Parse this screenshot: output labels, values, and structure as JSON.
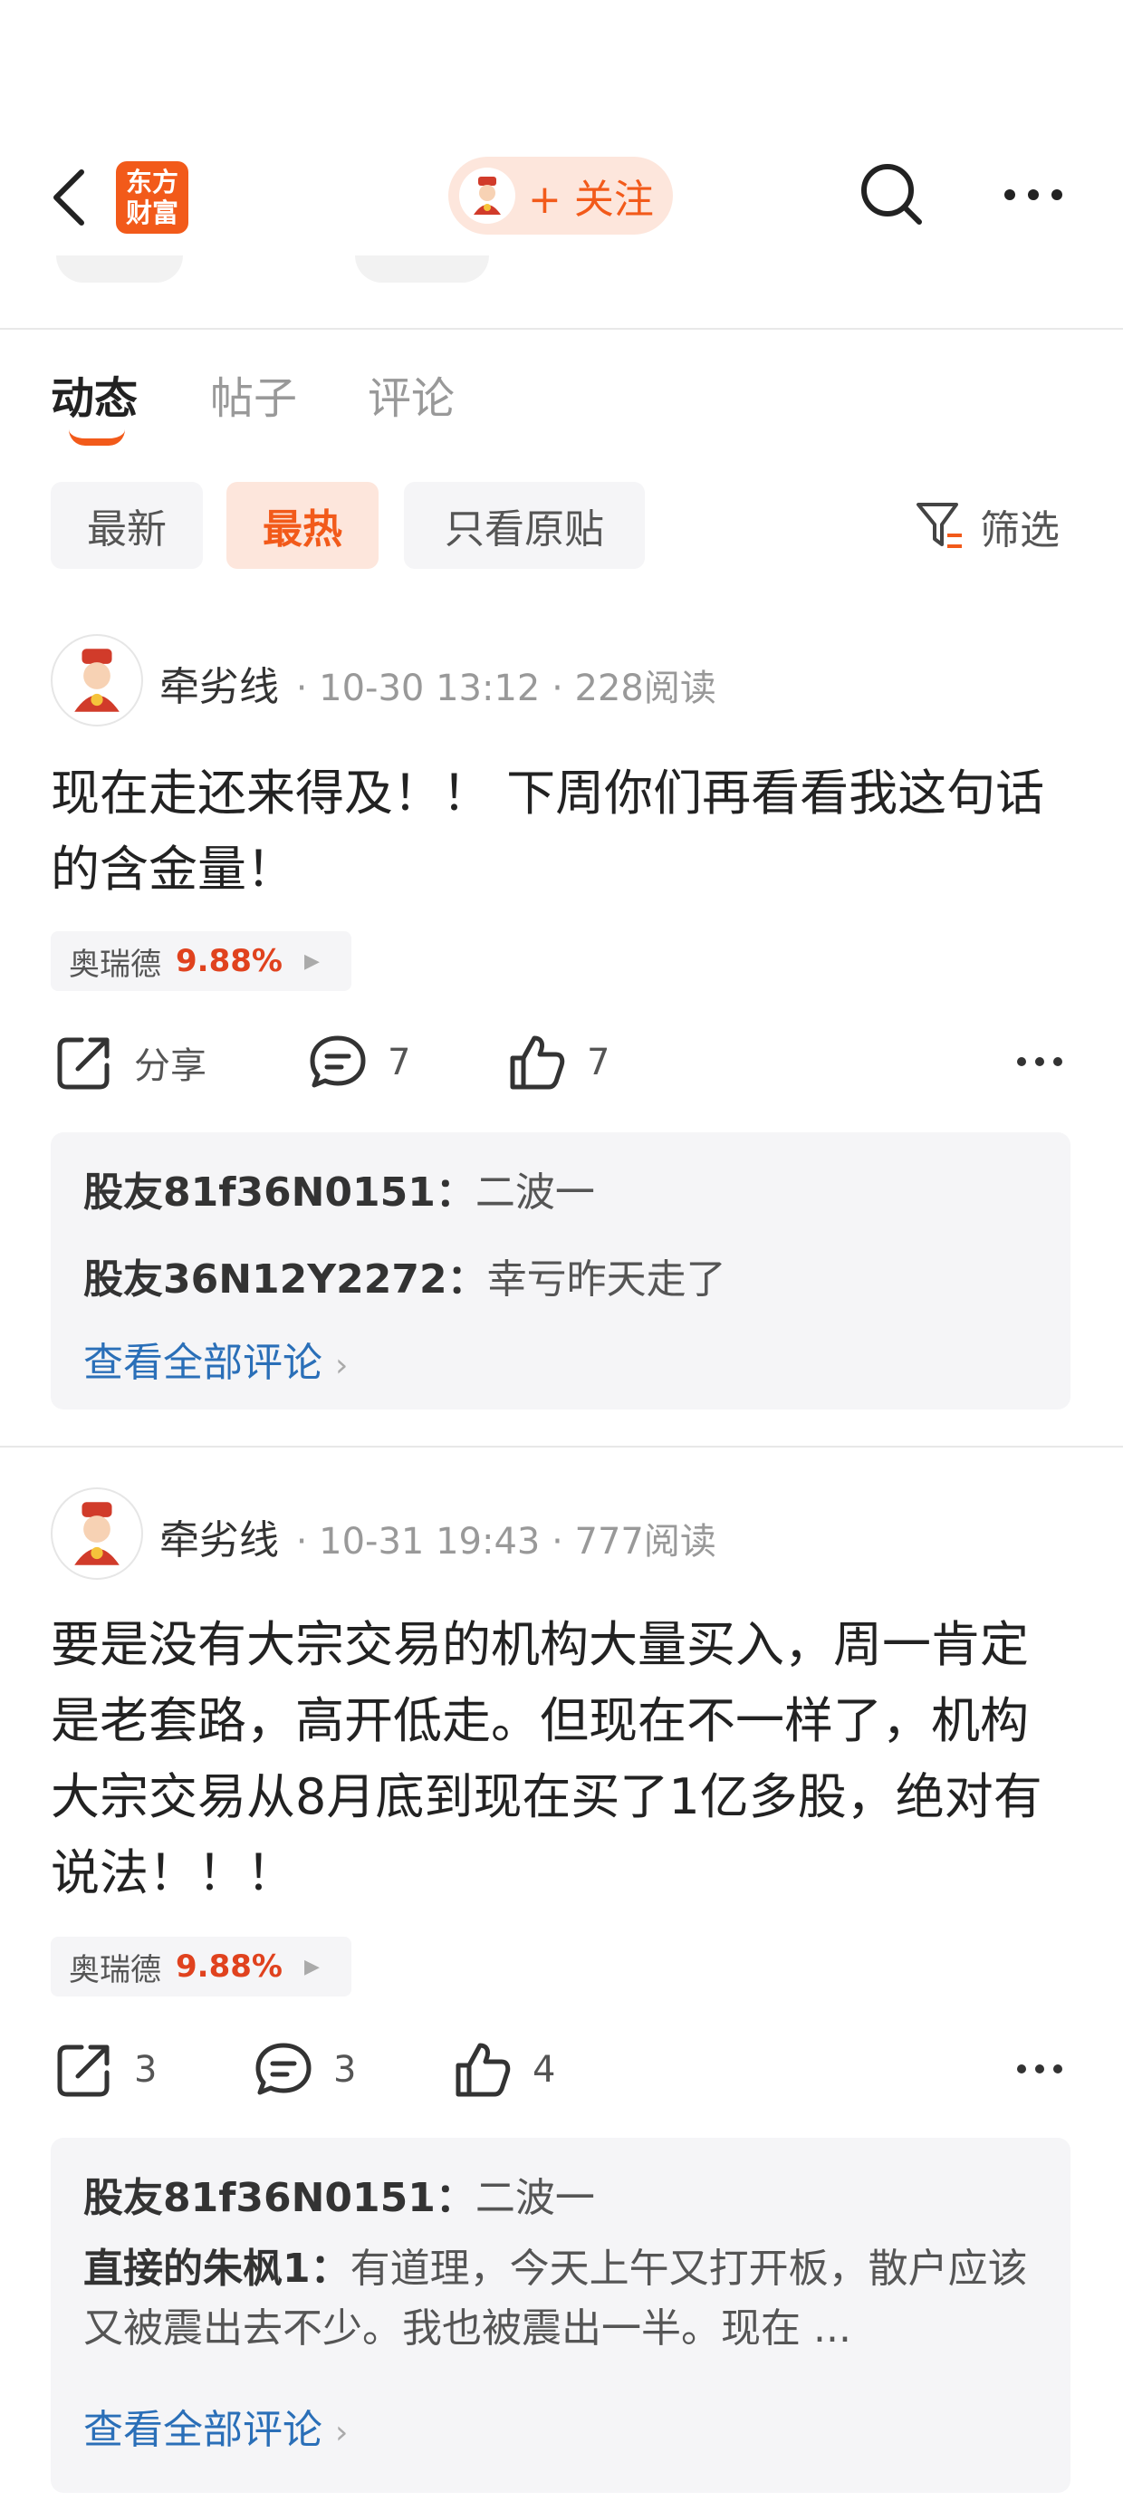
{
  "header": {
    "logo_line1": "东方",
    "logo_line2": "财富",
    "follow_label": "+ 关注"
  },
  "tabs": [
    {
      "label": "动态",
      "active": true
    },
    {
      "label": "帖子",
      "active": false
    },
    {
      "label": "评论",
      "active": false
    }
  ],
  "filters": {
    "chips": [
      {
        "label": "最新",
        "active": false
      },
      {
        "label": "最热",
        "active": true
      },
      {
        "label": "只看原贴",
        "active": false
      }
    ],
    "filter_label": "筛选"
  },
  "posts": [
    {
      "author": "牵劣线",
      "meta": "· 10-30 13:12 · 228阅读",
      "content": "现在走还来得及！！ 下周你们再看看我这句话的含金量！",
      "stock": {
        "name": "奥瑞德",
        "change": "9.88%"
      },
      "share_label": "分享",
      "comment_count": "7",
      "like_count": "7",
      "comments": [
        {
          "user": "股友81f36N0151：",
          "text": "二波一"
        },
        {
          "user": "股友36N12Y2272：",
          "text": "幸亏昨天走了"
        }
      ],
      "view_all": "查看全部评论"
    },
    {
      "author": "牵劣线",
      "meta": "· 10-31 19:43 · 777阅读",
      "content": "要是没有大宗交易的机构大量买入，周一肯定是老套路，高开低走。但现在不一样了，机构大宗交易从8月底到现在买了1亿多股，绝对有说法！！！",
      "stock": {
        "name": "奥瑞德",
        "change": "9.88%"
      },
      "share_label": "3",
      "comment_count": "3",
      "like_count": "4",
      "comments": [
        {
          "user": "股友81f36N0151：",
          "text": "二波一"
        },
        {
          "user": "直接的朱枫1：",
          "text": "有道理，今天上午又打开板，散户应该又被震出去不少。我也被震出一半。现在 ..."
        }
      ],
      "view_all": "查看全部评论"
    }
  ],
  "colors": {
    "accent": "#f25a1a",
    "link": "#2a6fb8",
    "up": "#e0421e"
  }
}
